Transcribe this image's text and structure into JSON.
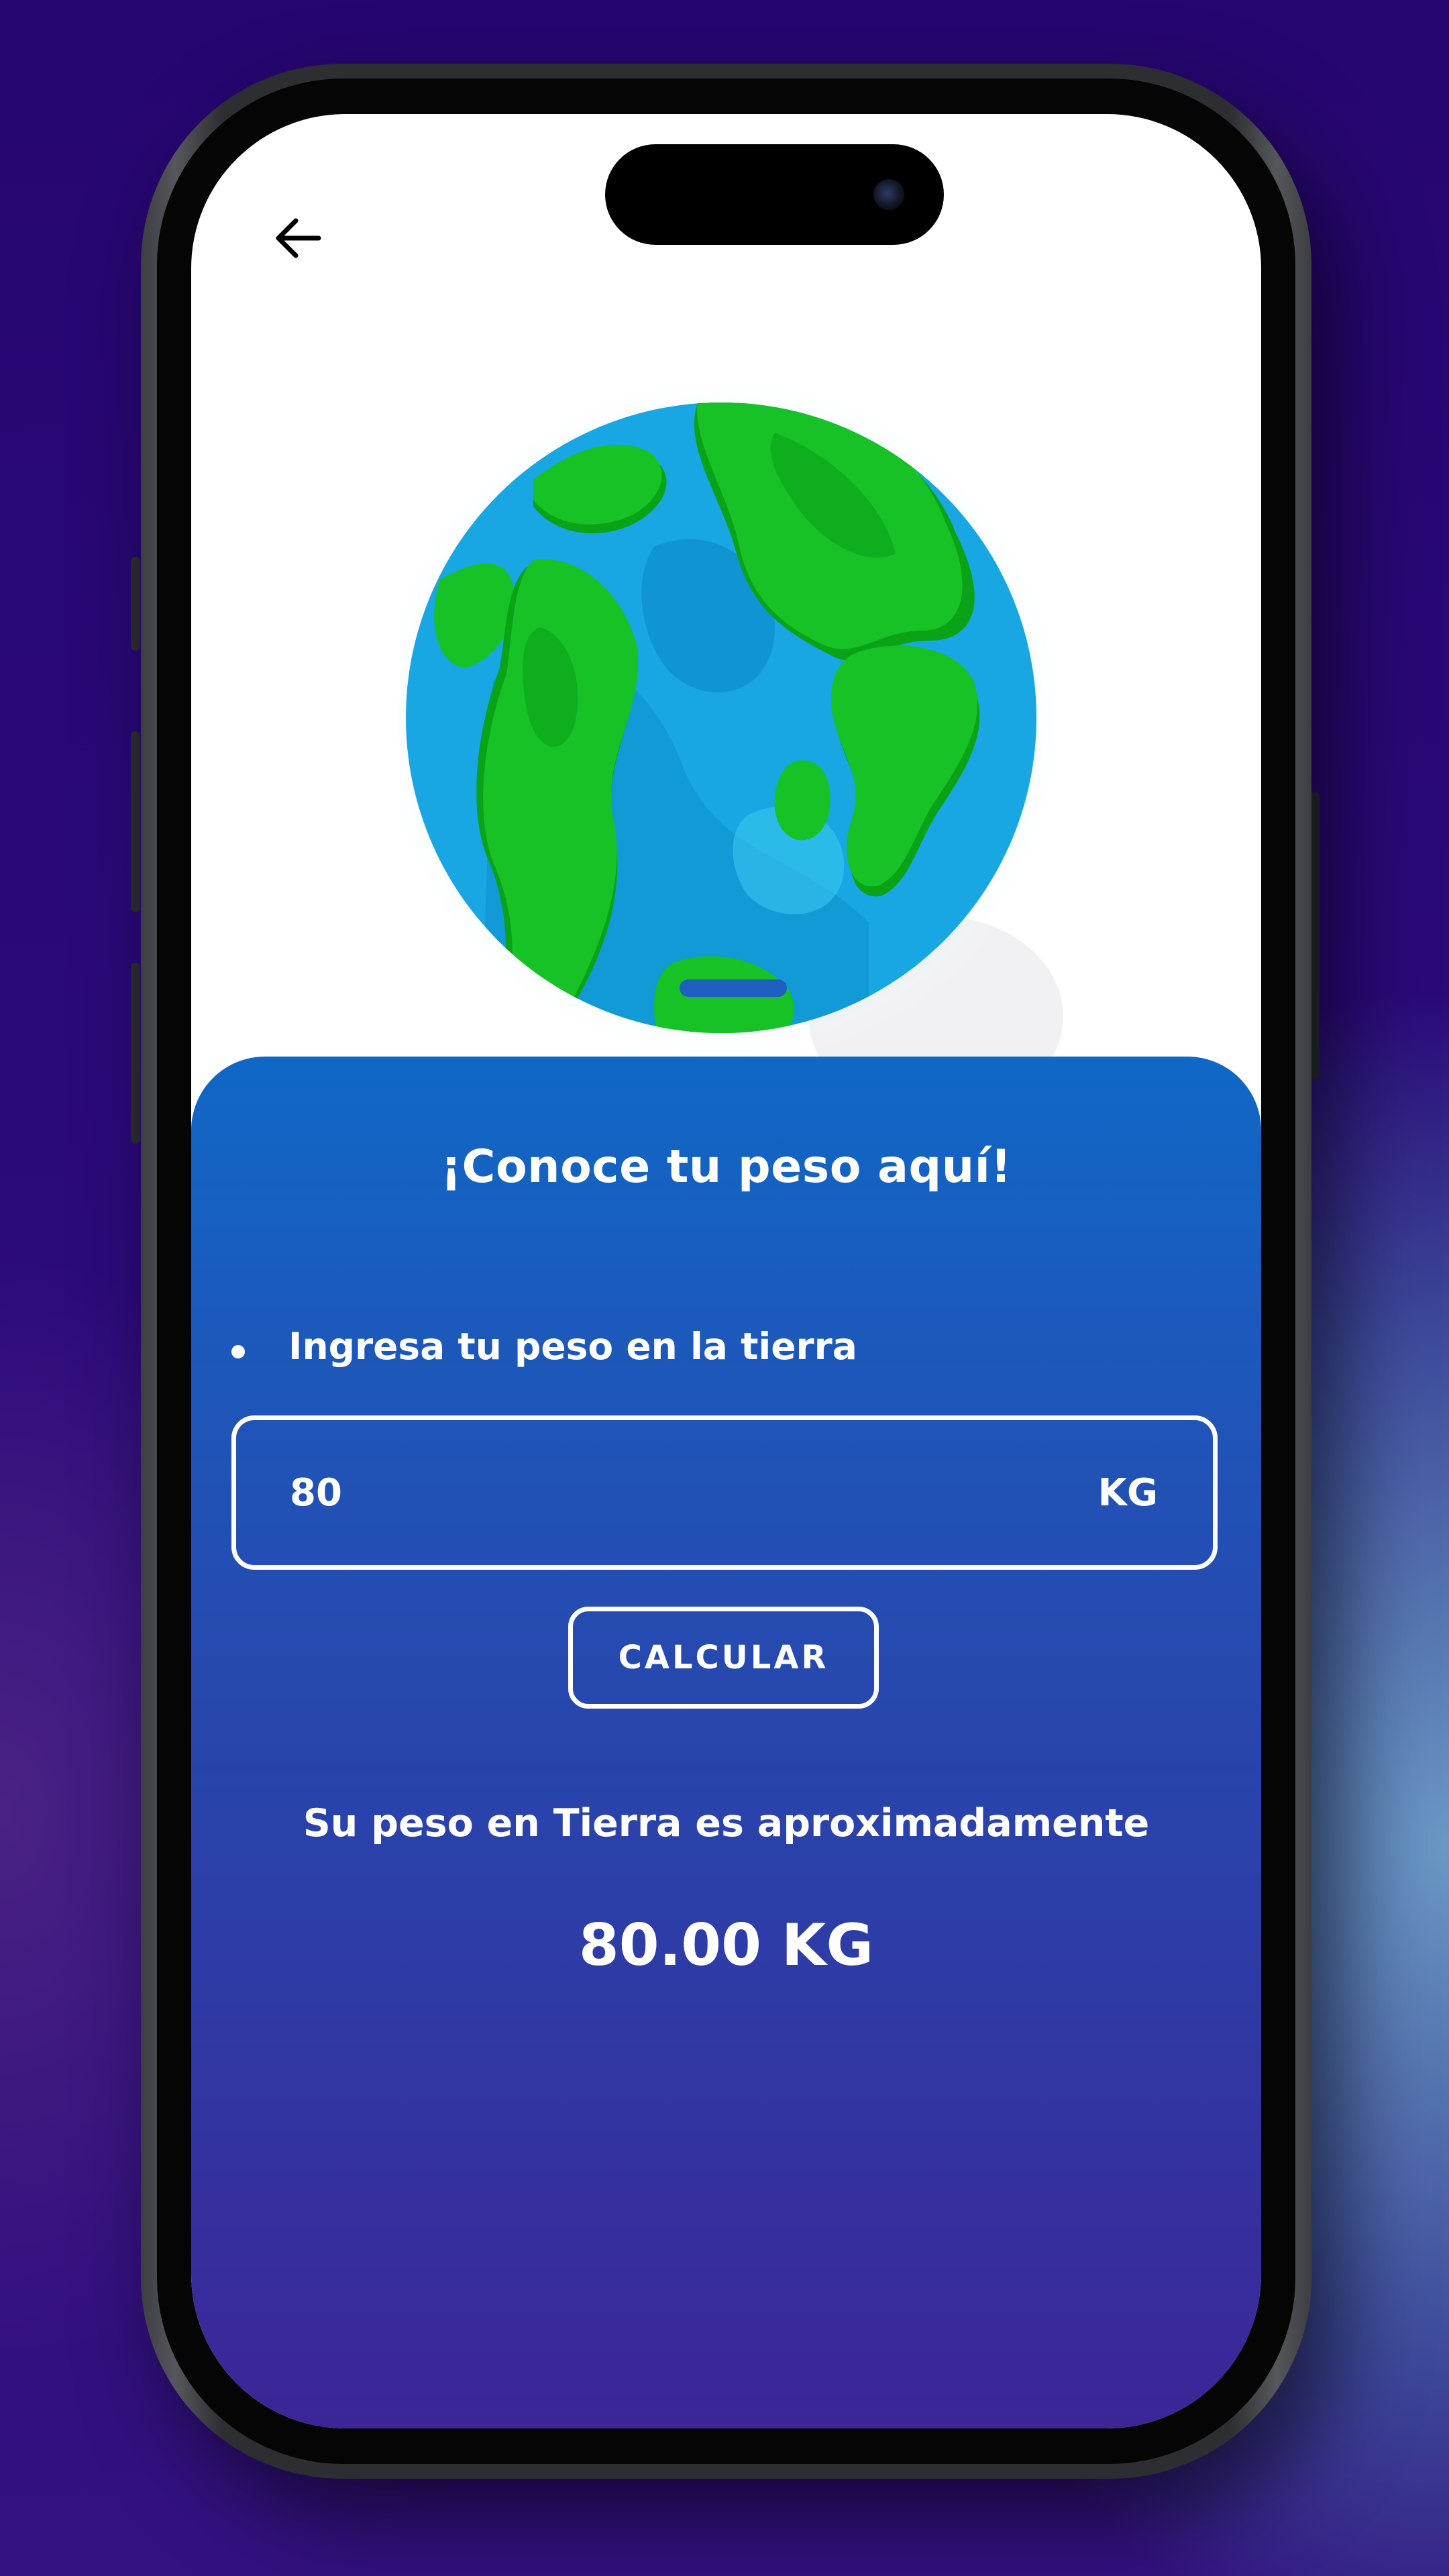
{
  "colors": {
    "background": "#2a0a78",
    "card_top": "#1068c6",
    "card_bottom": "#3c2597",
    "ocean": "#18a7e2",
    "land": "#17c227",
    "text": "#ffffff"
  },
  "header": {
    "back_icon": "arrow-left-icon"
  },
  "illustration": {
    "icon": "globe-earth-icon"
  },
  "card": {
    "title": "¡Conoce tu peso aquí!",
    "instruction": "Ingresa tu peso en la tierra",
    "weight_input": {
      "value": "80",
      "unit": "KG"
    },
    "calculate_label": "CALCULAR",
    "result_label": "Su peso en Tierra es aproximadamente",
    "result_value": "80.00 KG"
  }
}
